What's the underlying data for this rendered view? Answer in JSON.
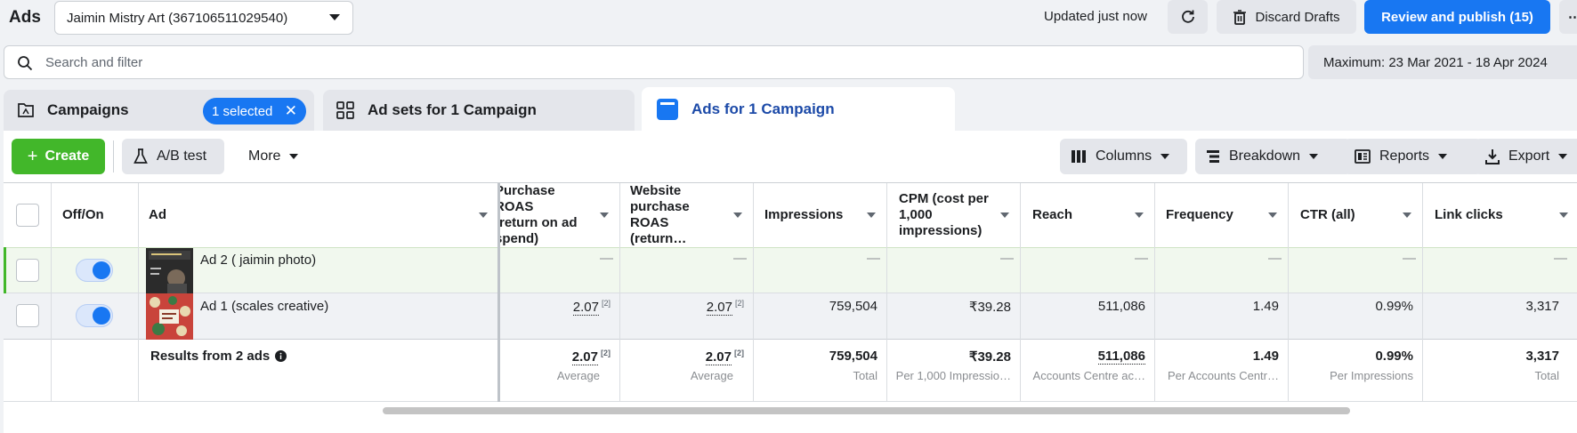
{
  "header": {
    "title": "Ads",
    "account_selector": "Jaimin Mistry Art (367106511029540)",
    "status": "Updated just now",
    "discard_label": "Discard Drafts",
    "publish_label": "Review and publish (15)",
    "more_label": "⋯"
  },
  "search": {
    "placeholder": "Search and filter",
    "date_range": "Maximum: 23 Mar 2021 - 18 Apr 2024"
  },
  "tabs": {
    "campaigns": "Campaigns",
    "selected_pill": "1 selected",
    "adsets": "Ad sets for 1 Campaign",
    "ads": "Ads for 1 Campaign"
  },
  "toolbar": {
    "create": "Create",
    "ab_test": "A/B test",
    "more": "More",
    "columns": "Columns",
    "breakdown": "Breakdown",
    "reports": "Reports",
    "export": "Export"
  },
  "table": {
    "headers": {
      "off_on": "Off/On",
      "ad": "Ad",
      "purchase_roas": "Purchase ROAS (return on ad spend)",
      "website_roas": "Website purchase ROAS (return…",
      "impressions": "Impressions",
      "cpm": "CPM (cost per 1,000 impressions)",
      "reach": "Reach",
      "frequency": "Frequency",
      "ctr": "CTR (all)",
      "link_clicks": "Link clicks"
    },
    "rows": [
      {
        "name": "Ad 2 ( jaimin photo)",
        "purchase_roas": "—",
        "website_roas": "—",
        "impressions": "—",
        "cpm": "—",
        "reach": "—",
        "frequency": "—",
        "ctr": "—",
        "link_clicks": "—"
      },
      {
        "name": "Ad 1 (scales creative)",
        "purchase_roas": "2.07",
        "purchase_roas_note": "[2]",
        "website_roas": "2.07",
        "website_roas_note": "[2]",
        "impressions": "759,504",
        "cpm": "₹39.28",
        "reach": "511,086",
        "frequency": "1.49",
        "ctr": "0.99%",
        "link_clicks": "3,317"
      }
    ],
    "totals": {
      "label": "Results from 2 ads",
      "purchase_roas": "2.07",
      "purchase_roas_note": "[2]",
      "purchase_roas_sub": "Average",
      "website_roas": "2.07",
      "website_roas_note": "[2]",
      "website_roas_sub": "Average",
      "impressions": "759,504",
      "impressions_sub": "Total",
      "cpm": "₹39.28",
      "cpm_sub": "Per 1,000 Impressio…",
      "reach": "511,086",
      "reach_sub": "Accounts Centre ac…",
      "frequency": "1.49",
      "frequency_sub": "Per Accounts Centr…",
      "ctr": "0.99%",
      "ctr_sub": "Per Impressions",
      "link_clicks": "3,317",
      "link_clicks_sub": "Total"
    }
  },
  "colors": {
    "primary": "#1877f2",
    "create_green": "#42b72a",
    "active_tab_text": "#1c4aa8"
  },
  "icons": [
    "refresh-icon",
    "trash-icon",
    "search-icon",
    "folder-icon",
    "grid-icon",
    "ads-icon",
    "flask-icon",
    "columns-icon",
    "breakdown-icon",
    "reports-icon",
    "export-icon",
    "info-icon"
  ]
}
